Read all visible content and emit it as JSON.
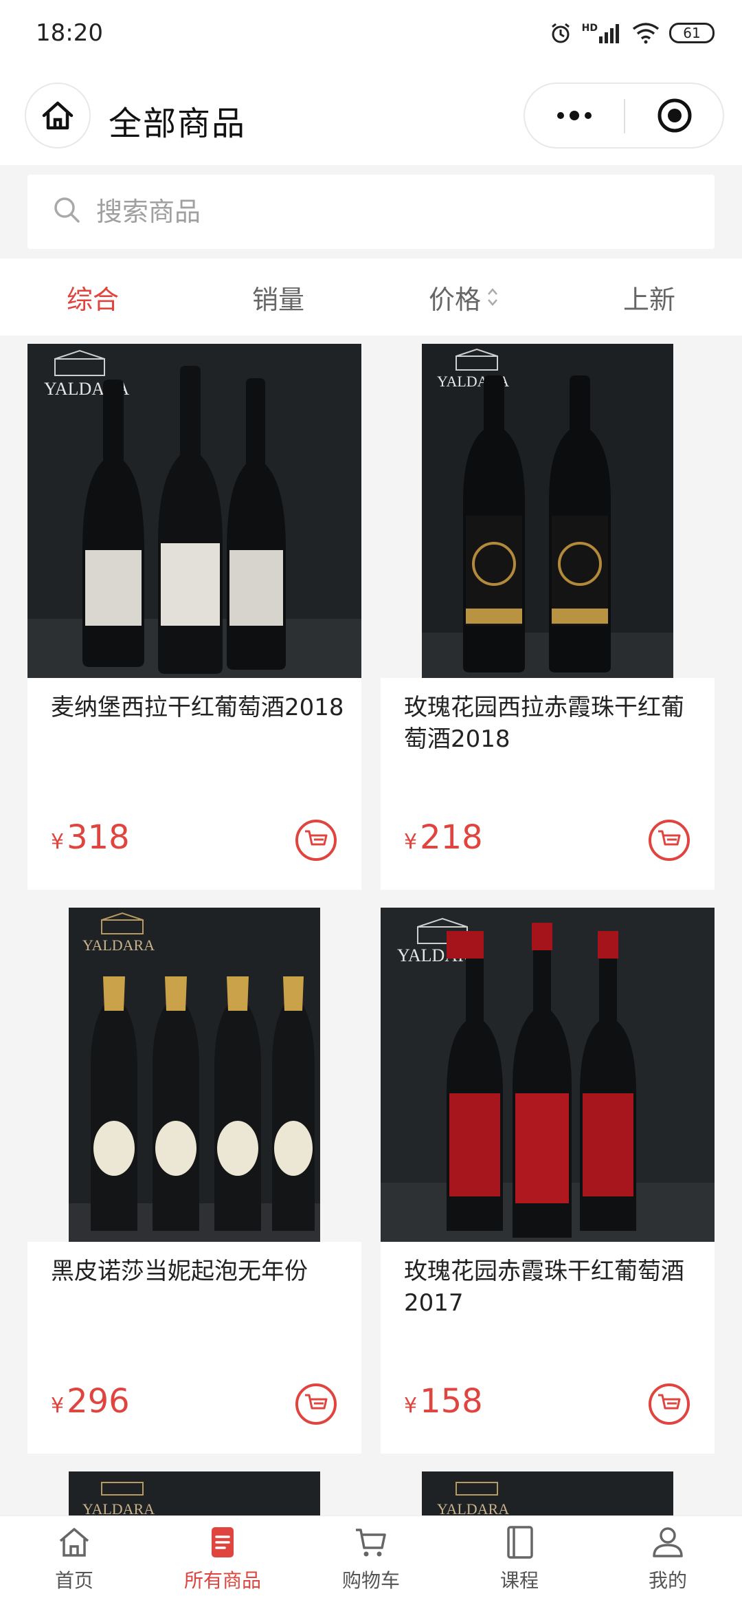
{
  "status_bar": {
    "time": "18:20",
    "battery": "61",
    "network": "HD"
  },
  "nav": {
    "title": "全部商品"
  },
  "search": {
    "placeholder": "搜索商品"
  },
  "sort_tabs": [
    {
      "label": "综合",
      "active": true
    },
    {
      "label": "销量",
      "active": false
    },
    {
      "label": "价格",
      "active": false
    },
    {
      "label": "上新",
      "active": false
    }
  ],
  "products": [
    {
      "name": "麦纳堡西拉干红葡萄酒2018",
      "currency": "¥",
      "price": "318",
      "image_brand": "YALDARA"
    },
    {
      "name": "玫瑰花园西拉赤霞珠干红葡萄酒2018",
      "currency": "¥",
      "price": "218",
      "image_brand": "YALDARA"
    },
    {
      "name": "黑皮诺莎当妮起泡无年份",
      "currency": "¥",
      "price": "296",
      "image_brand": "YALDARA"
    },
    {
      "name": "玫瑰花园赤霞珠干红葡萄酒2017",
      "currency": "¥",
      "price": "158",
      "image_brand": "YALDARA"
    },
    {
      "image_brand": "YALDARA"
    },
    {
      "image_brand": "YALDARA"
    }
  ],
  "tabbar": [
    {
      "label": "首页",
      "icon": "home-icon",
      "active": false
    },
    {
      "label": "所有商品",
      "icon": "list-icon",
      "active": true
    },
    {
      "label": "购物车",
      "icon": "cart-icon",
      "active": false
    },
    {
      "label": "课程",
      "icon": "book-icon",
      "active": false
    },
    {
      "label": "我的",
      "icon": "user-icon",
      "active": false
    }
  ],
  "colors": {
    "accent": "#e0443e",
    "background": "#f4f4f4"
  }
}
